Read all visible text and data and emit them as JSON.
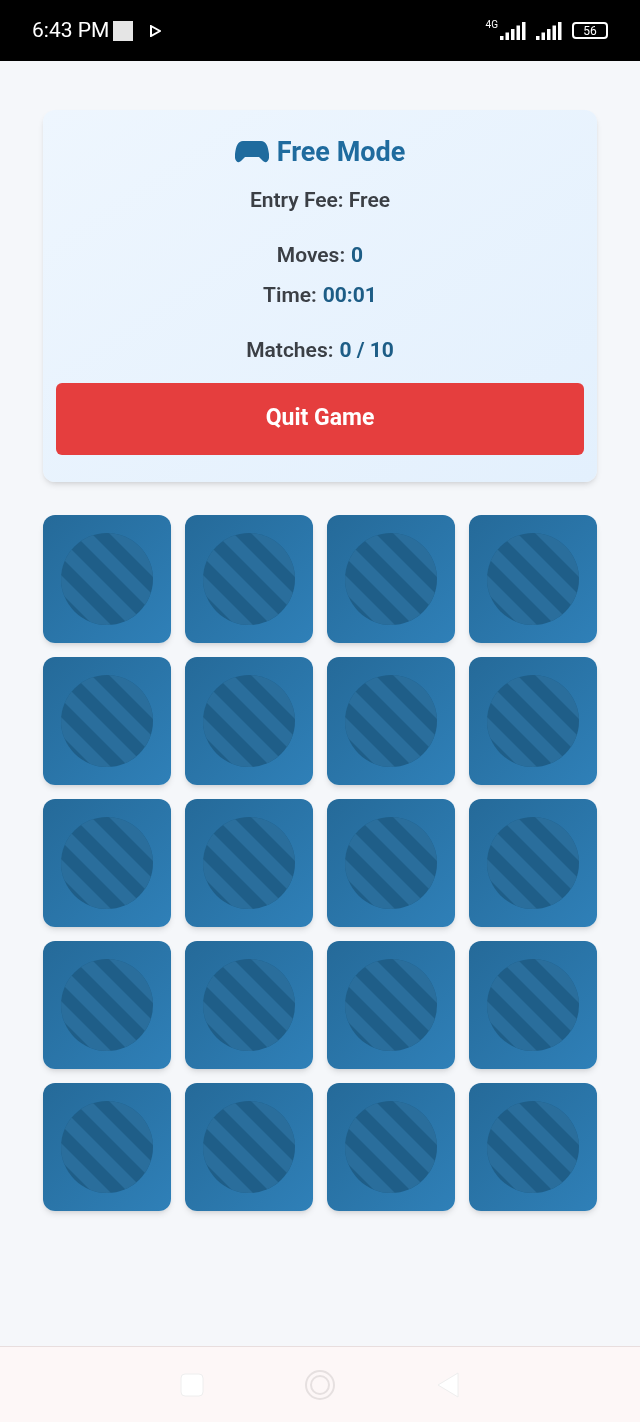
{
  "status_bar": {
    "time": "6:43 PM",
    "network": "4G",
    "battery": "56"
  },
  "panel": {
    "title": "Free Mode",
    "entry_fee": "Entry Fee: Free",
    "stat_groups": [
      [
        {
          "label": "Moves:",
          "value": "0"
        },
        {
          "label": "Time:",
          "value": "00:01"
        }
      ],
      [
        {
          "label": "Matches:",
          "value": "0 / 10"
        }
      ]
    ],
    "quit_button": "Quit Game"
  },
  "cards": [
    {
      "kind": "face-down"
    },
    {
      "kind": "face-down"
    },
    {
      "kind": "face-down"
    },
    {
      "kind": "face-down"
    },
    {
      "kind": "face-down"
    },
    {
      "kind": "face-down"
    },
    {
      "kind": "face-down"
    },
    {
      "kind": "face-down"
    },
    {
      "kind": "face-down"
    },
    {
      "kind": "face-down"
    },
    {
      "kind": "face-down"
    },
    {
      "kind": "face-down"
    },
    {
      "kind": "face-down"
    },
    {
      "kind": "face-down"
    },
    {
      "kind": "face-down"
    },
    {
      "kind": "face-down"
    },
    {
      "kind": "face-down"
    },
    {
      "kind": "face-down"
    },
    {
      "kind": "face-down"
    },
    {
      "kind": "face-down"
    }
  ]
}
